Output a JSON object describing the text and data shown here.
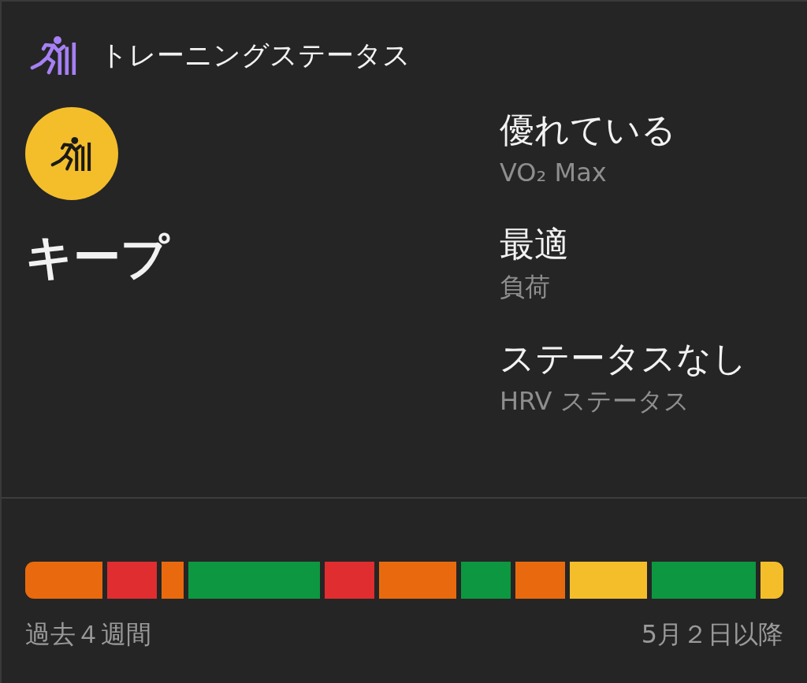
{
  "header": {
    "title": "トレーニングステータス"
  },
  "status": {
    "label": "キープ"
  },
  "metrics": [
    {
      "value": "優れている",
      "name": "VO₂ Max"
    },
    {
      "value": "最適",
      "name": "負荷"
    },
    {
      "value": "ステータスなし",
      "name": "HRV ステータス"
    }
  ],
  "history": {
    "days": [
      {
        "color": "#e96a0e"
      },
      {
        "color": "#e96a0e"
      },
      {
        "color": "#e96a0e"
      },
      {
        "color": "#e02d30"
      },
      {
        "color": "#e02d30"
      },
      {
        "color": "#e96a0e"
      },
      {
        "color": "#0d9740"
      },
      {
        "color": "#0d9740"
      },
      {
        "color": "#0d9740"
      },
      {
        "color": "#0d9740"
      },
      {
        "color": "#0d9740"
      },
      {
        "color": "#e02d30"
      },
      {
        "color": "#e02d30"
      },
      {
        "color": "#e96a0e"
      },
      {
        "color": "#e96a0e"
      },
      {
        "color": "#e96a0e"
      },
      {
        "color": "#0d9740"
      },
      {
        "color": "#0d9740"
      },
      {
        "color": "#e96a0e"
      },
      {
        "color": "#e96a0e"
      },
      {
        "color": "#f4be2b"
      },
      {
        "color": "#f4be2b"
      },
      {
        "color": "#f4be2b"
      },
      {
        "color": "#0d9740"
      },
      {
        "color": "#0d9740"
      },
      {
        "color": "#0d9740"
      },
      {
        "color": "#0d9740"
      },
      {
        "color": "#f4be2b"
      }
    ],
    "start_label": "過去４週間",
    "end_label": "5月２日以降"
  }
}
